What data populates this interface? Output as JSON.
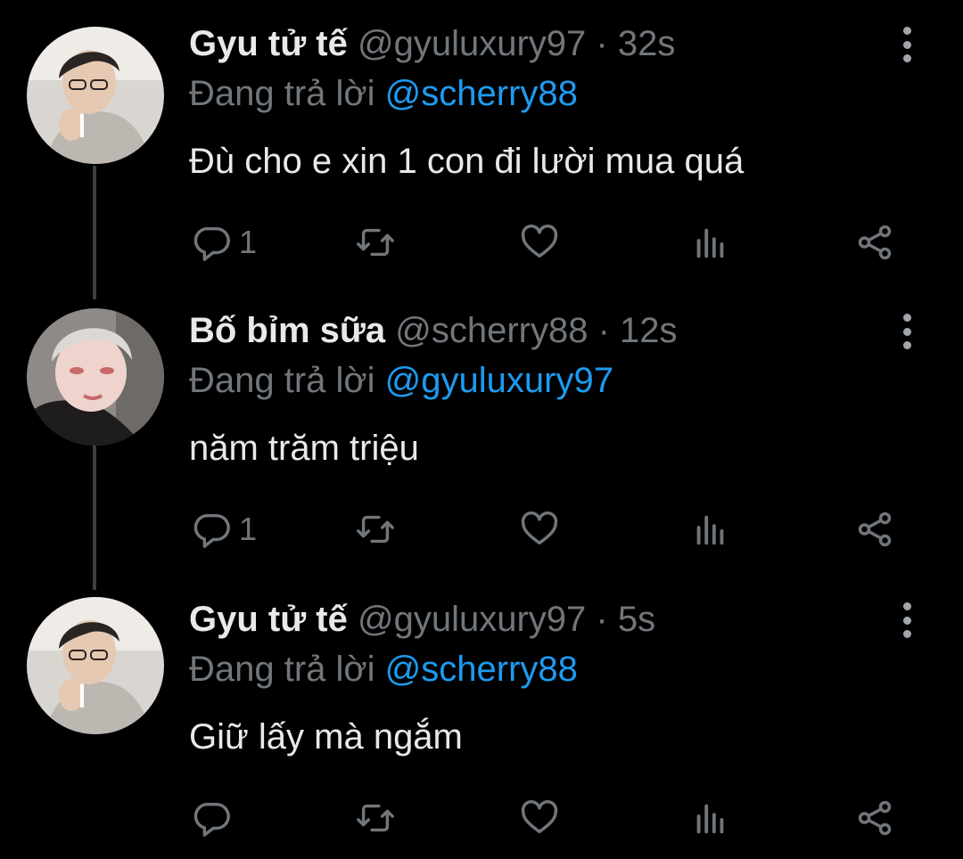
{
  "colors": {
    "background": "#000000",
    "name": "#e7e9ea",
    "meta": "#71767b",
    "mention": "#1d9bf0",
    "thread_line": "#3a3f44"
  },
  "tweets": [
    {
      "name": "Gyu tử tế",
      "handle": "@gyuluxury97",
      "time": "· 32s",
      "reply_prefix": "Đang trả lời",
      "reply_to": "@scherry88",
      "text": "Đù cho e xin 1 con đi lười mua quá",
      "reply_count": "1"
    },
    {
      "name": "Bố bỉm sữa",
      "handle": "@scherry88",
      "time": "· 12s",
      "reply_prefix": "Đang trả lời",
      "reply_to": "@gyuluxury97",
      "text": "năm trăm triệu",
      "reply_count": "1"
    },
    {
      "name": "Gyu tử tế",
      "handle": "@gyuluxury97",
      "time": "· 5s",
      "reply_prefix": "Đang trả lời",
      "reply_to": "@scherry88",
      "text": "Giữ lấy mà ngắm",
      "reply_count": ""
    }
  ],
  "icons": [
    "reply-icon",
    "retweet-icon",
    "like-icon",
    "analytics-icon",
    "share-icon",
    "more-options-icon"
  ]
}
